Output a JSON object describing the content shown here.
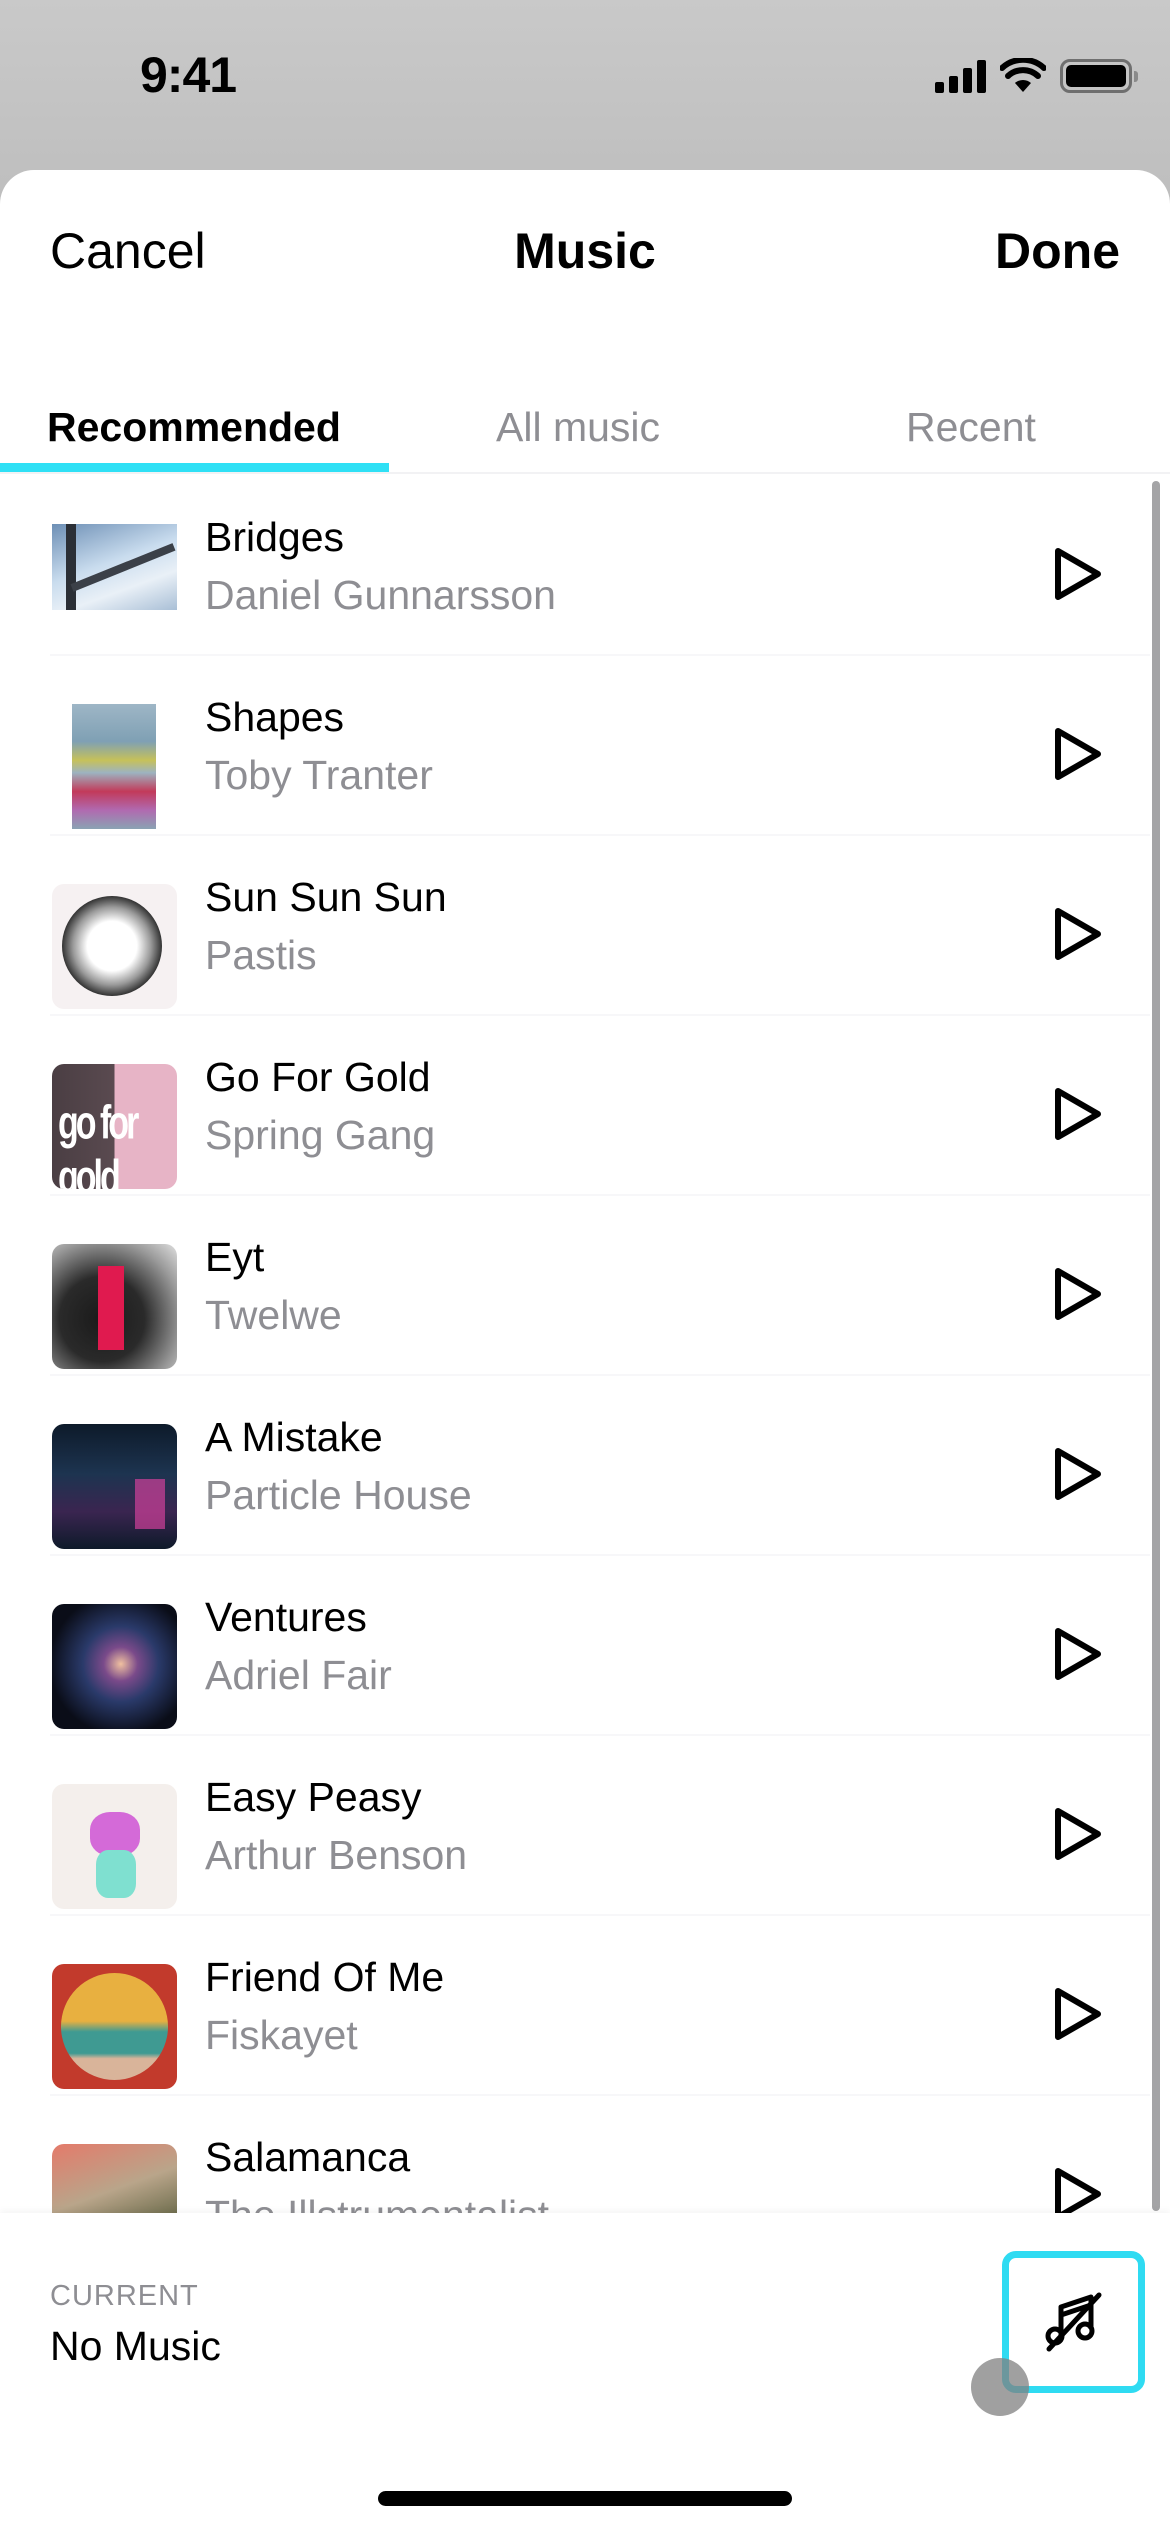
{
  "status_bar": {
    "time": "9:41",
    "icons": [
      "cellular-signal-icon",
      "wifi-icon",
      "battery-icon"
    ]
  },
  "header": {
    "cancel_label": "Cancel",
    "title": "Music",
    "done_label": "Done"
  },
  "tabs": [
    {
      "label": "Recommended",
      "active": true
    },
    {
      "label": "All music",
      "active": false
    },
    {
      "label": "Recent",
      "active": false
    }
  ],
  "accent_color": "#2fe0f5",
  "songs": [
    {
      "title": "Bridges",
      "artist": "Daniel Gunnarsson",
      "art": "bridge-photo"
    },
    {
      "title": "Shapes",
      "artist": "Toby Tranter",
      "art": "colorful-shapes"
    },
    {
      "title": "Sun Sun Sun",
      "artist": "Pastis",
      "art": "ink-circle"
    },
    {
      "title": "Go For Gold",
      "artist": "Spring Gang",
      "art": "go-for-gold-pink"
    },
    {
      "title": "Eyt",
      "artist": "Twelwe",
      "art": "dark-red-type"
    },
    {
      "title": "A Mistake",
      "artist": "Particle House",
      "art": "neon-city"
    },
    {
      "title": "Ventures",
      "artist": "Adriel Fair",
      "art": "galaxy"
    },
    {
      "title": "Easy Peasy",
      "artist": "Arthur Benson",
      "art": "pastel-figure"
    },
    {
      "title": "Friend Of Me",
      "artist": "Fiskayet",
      "art": "sunset-circle"
    },
    {
      "title": "Salamanca",
      "artist": "The Illstrumentalist",
      "art": "collage-photo"
    }
  ],
  "current": {
    "label": "CURRENT",
    "value": "No Music"
  },
  "no_music_button": {
    "icon": "music-note-slash-icon"
  }
}
